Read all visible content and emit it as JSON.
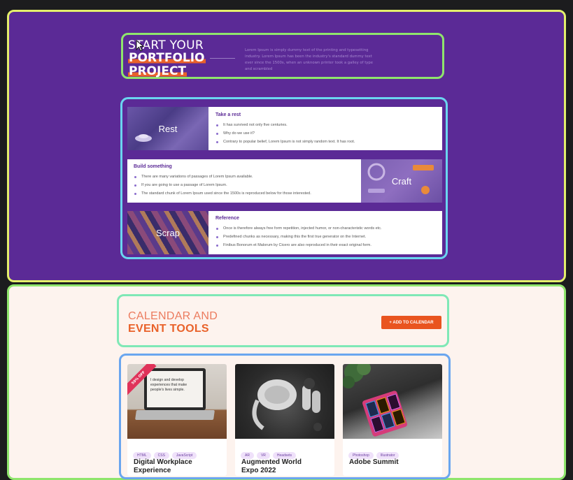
{
  "portfolio": {
    "line1": "START YOUR",
    "line2": "PORTFOLIO",
    "line3": "PROJECT",
    "description": "Lorem Ipsum is simply dummy text of the printing and typesetting industry. Lorem Ipsum has been the industry's standard dummy text ever since the 1500s, when an unknown printer took a galley of type and scrambled"
  },
  "rows": [
    {
      "image_label": "Rest",
      "title": "Take a rest",
      "bullets": [
        "It has survived not only five centuries.",
        "Why do we use it?",
        "Contrary to popular belief, Lorem Ipsum is not simply random text. It has root."
      ]
    },
    {
      "image_label": "Craft",
      "title": "Build something",
      "bullets": [
        "There are many variations of passages of Lorem Ipsum available.",
        "If you are going to use a passage of Lorem Ipsum.",
        "The standard chunk of Lorem Ipsum used since the 1500s is reproduced below for those interested."
      ]
    },
    {
      "image_label": "Scrap",
      "title": "Reference",
      "bullets": [
        "Once is therefore always free form repetition, injected humor, or non-characteristic words etc.",
        "Predefined chunks as necessary, making this the first true generator on the Internet.",
        "Finibus Bonorum et Malorum by Cicero are also reproduced in their exact original form."
      ]
    }
  ],
  "calendar": {
    "line1": "CALENDAR AND",
    "line2": "EVENT TOOLS",
    "add_button": "+ ADD TO CALENDAR"
  },
  "events": [
    {
      "ribbon": "50% OFF",
      "screen_text": "I design and develop experiences that make people's lives simple.",
      "tags": [
        "HTML",
        "CSS",
        "JavaScript"
      ],
      "title": "Digital Workplace Experience"
    },
    {
      "tags": [
        "AR",
        "VR",
        "Headsets"
      ],
      "title": "Augmented World Expo 2022"
    },
    {
      "tags": [
        "Photoshop",
        "Illustrator"
      ],
      "title": "Adobe Summit"
    }
  ],
  "colors": {
    "purple": "#5b2a96",
    "orange": "#e9622a",
    "cream": "#fdf3ee"
  }
}
